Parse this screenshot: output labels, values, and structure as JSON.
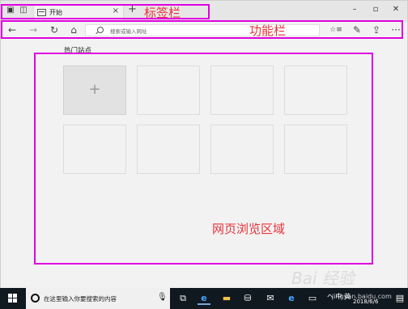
{
  "titlebar": {
    "tab": {
      "title": "开始",
      "close": "×"
    },
    "new_tab": "+",
    "controls": {
      "minimize": "–",
      "maximize": "▫",
      "close": "✕"
    }
  },
  "navbar": {
    "back": "←",
    "forward": "→",
    "refresh": "↻",
    "home": "⌂",
    "address_placeholder": "搜索或输入网址",
    "favorites": "☆≡",
    "notes": "✎",
    "share": "⇪",
    "more": "···"
  },
  "content": {
    "section_title": "热门站点",
    "add_tile": "+"
  },
  "annotations": {
    "tab_bar": "标签栏",
    "function_bar": "功能栏",
    "browse_area": "网页浏览区域",
    "color": "#e000e0",
    "label_color": "#e8333a"
  },
  "taskbar": {
    "search_placeholder": "在这里输入你要搜索的内容",
    "tray_text": "ヘ 中 英",
    "date": "2018/6/6"
  },
  "watermark": {
    "text": "Bai 经验",
    "url": "jingyan.baidu.com"
  }
}
